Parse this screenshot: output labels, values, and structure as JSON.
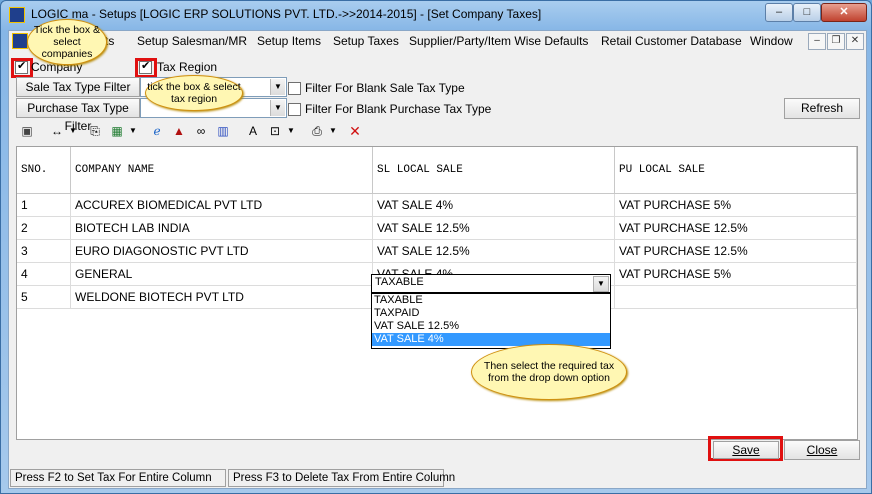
{
  "window": {
    "title_prefix": "LOGIC",
    "title_rest": "ma - Setups  [LOGIC ERP SOLUTIONS PVT. LTD.->>2014-2015]  - [Set Company Taxes]",
    "controls": [
      "–",
      "□",
      "✕"
    ]
  },
  "menu": {
    "items": [
      "ts",
      "Setup Salesman/MR",
      "Setup Items",
      "Setup Taxes",
      "Supplier/Party/Item Wise Defaults",
      "Retail Customer Database",
      "Window"
    ],
    "mdi_controls": [
      "–",
      "❐",
      "✕"
    ]
  },
  "filters": {
    "company_label": "Company",
    "company_checked": true,
    "tax_region_label": "Tax Region",
    "tax_region_checked": true,
    "sale_filter_label": "Sale Tax Type Filter",
    "purchase_filter_label": "Purchase Tax Type Filter",
    "blank_sale_label": "Filter For Blank Sale Tax Type",
    "blank_purchase_label": "Filter For Blank Purchase Tax Type",
    "refresh_label": "Refresh"
  },
  "grid": {
    "columns": [
      "SNO.",
      "COMPANY NAME",
      "SL LOCAL SALE",
      "PU LOCAL SALE"
    ],
    "rows": [
      [
        "1",
        "ACCUREX BIOMEDICAL PVT LTD",
        "VAT SALE 4%",
        "VAT PURCHASE 5%"
      ],
      [
        "2",
        "BIOTECH LAB INDIA",
        "VAT SALE 12.5%",
        "VAT PURCHASE 12.5%"
      ],
      [
        "3",
        "EURO DIAGONOSTIC PVT LTD",
        "VAT SALE 12.5%",
        "VAT PURCHASE 12.5%"
      ],
      [
        "4",
        "GENERAL",
        "VAT SALE 4%",
        "VAT PURCHASE 5%"
      ],
      [
        "5",
        "WELDONE BIOTECH PVT LTD",
        "",
        ""
      ]
    ],
    "dropdown_value": "TAXABLE",
    "dropdown_options": [
      "TAXABLE",
      "TAXPAID",
      "VAT SALE 12.5%",
      "VAT SALE 4%"
    ],
    "dropdown_selected": "VAT SALE 4%"
  },
  "callouts": {
    "company": "Tick the box & select companies",
    "tax_region": "tick the box & select tax region",
    "dropdown": "Then select the required tax from the drop down option"
  },
  "buttons": {
    "save": "Save",
    "close": "Close"
  },
  "status": {
    "pane1": "Press F2 to Set Tax For Entire Column",
    "pane2": "Press F3 to Delete Tax From Entire Column"
  }
}
